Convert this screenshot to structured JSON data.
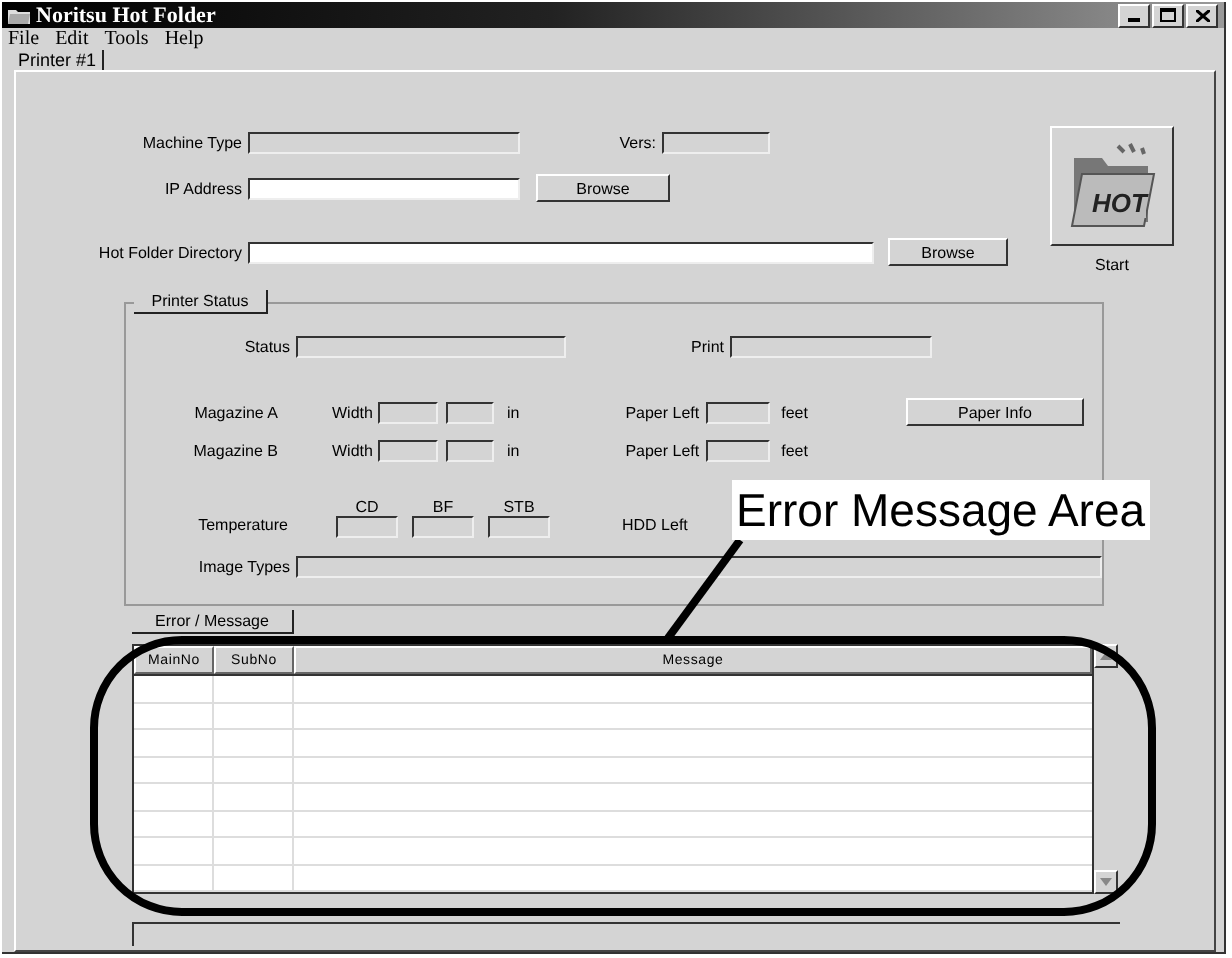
{
  "window": {
    "title": "Noritsu Hot Folder"
  },
  "menu": [
    "File",
    "Edit",
    "Tools",
    "Help"
  ],
  "tabs": [
    {
      "label": "Printer #1",
      "selected": true
    }
  ],
  "machine_type": {
    "label": "Machine Type"
  },
  "vers": {
    "label": "Vers:"
  },
  "ip_address": {
    "label": "IP Address",
    "button": "Browse"
  },
  "hot_folder_directory": {
    "label": "Hot Folder Directory",
    "button": "Browse"
  },
  "start_button": {
    "logo": "HOT",
    "label": "Start"
  },
  "printer_status": {
    "title": "Printer Status",
    "status_label": "Status",
    "print_label": "Print",
    "magazines": [
      {
        "label": "Magazine A",
        "width_label": "Width",
        "unit": "in",
        "paper_left_label": "Paper Left",
        "paper_unit": "feet"
      },
      {
        "label": "Magazine B",
        "width_label": "Width",
        "unit": "in",
        "paper_left_label": "Paper Left",
        "paper_unit": "feet"
      }
    ],
    "paper_info_button": "Paper Info",
    "temperature": {
      "label": "Temperature",
      "columns": [
        "CD",
        "BF",
        "STB"
      ]
    },
    "hdd_left_label": "HDD Left",
    "image_types_label": "Image Types"
  },
  "error_message": {
    "tab": "Error / Message",
    "columns": [
      "MainNo",
      "SubNo",
      "Message"
    ]
  },
  "callout": {
    "text": "Error Message Area"
  }
}
